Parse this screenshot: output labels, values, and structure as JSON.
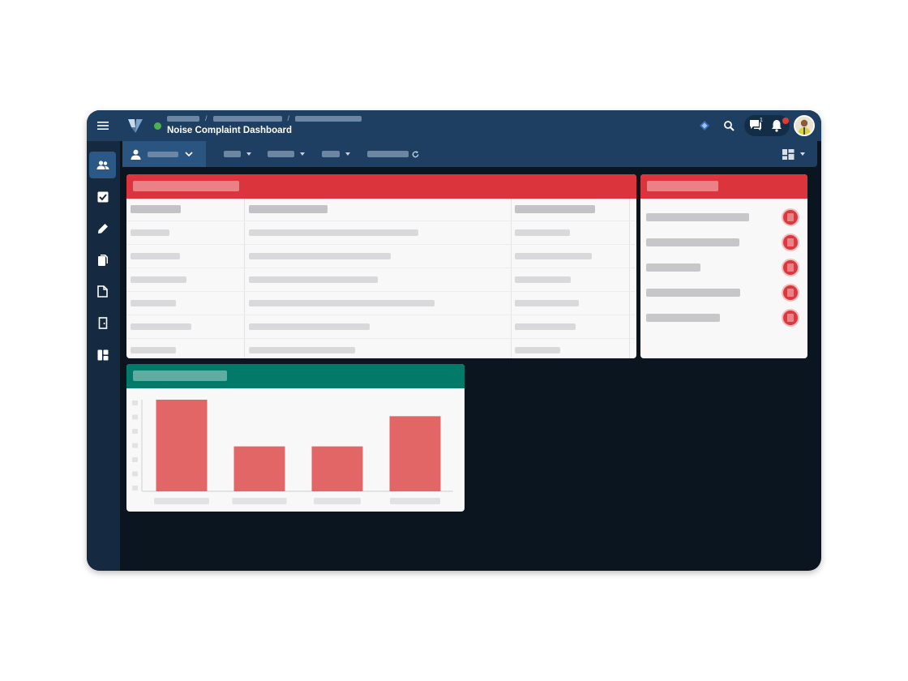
{
  "header": {
    "title": "Noise Complaint Dashboard",
    "notifications_count": "1"
  },
  "colors": {
    "navy": "#1f3f62",
    "panel_header_red": "#dc343c",
    "panel_header_teal": "#017a6a",
    "bar_fill": "#e26666",
    "status_green": "#4caf50"
  },
  "icons": {
    "menu": "hamburger-icon",
    "search": "search-icon",
    "chat": "chat-icon",
    "notifications": "bell-icon",
    "layout": "dashboard-layout-icon"
  },
  "sidebar": {
    "items": [
      {
        "icon": "users-icon",
        "active": true
      },
      {
        "icon": "checkbox-icon",
        "active": false
      },
      {
        "icon": "pencil-icon",
        "active": false
      },
      {
        "icon": "documents-icon",
        "active": false
      },
      {
        "icon": "page-icon",
        "active": false
      },
      {
        "icon": "door-icon",
        "active": false
      },
      {
        "icon": "dashboard-icon",
        "active": false
      }
    ]
  },
  "chart_data": {
    "type": "bar",
    "categories": [
      "",
      "",
      "",
      ""
    ],
    "values": [
      100,
      49,
      49,
      82
    ],
    "ylim": [
      0,
      100
    ],
    "grid": false,
    "legend": "none"
  }
}
